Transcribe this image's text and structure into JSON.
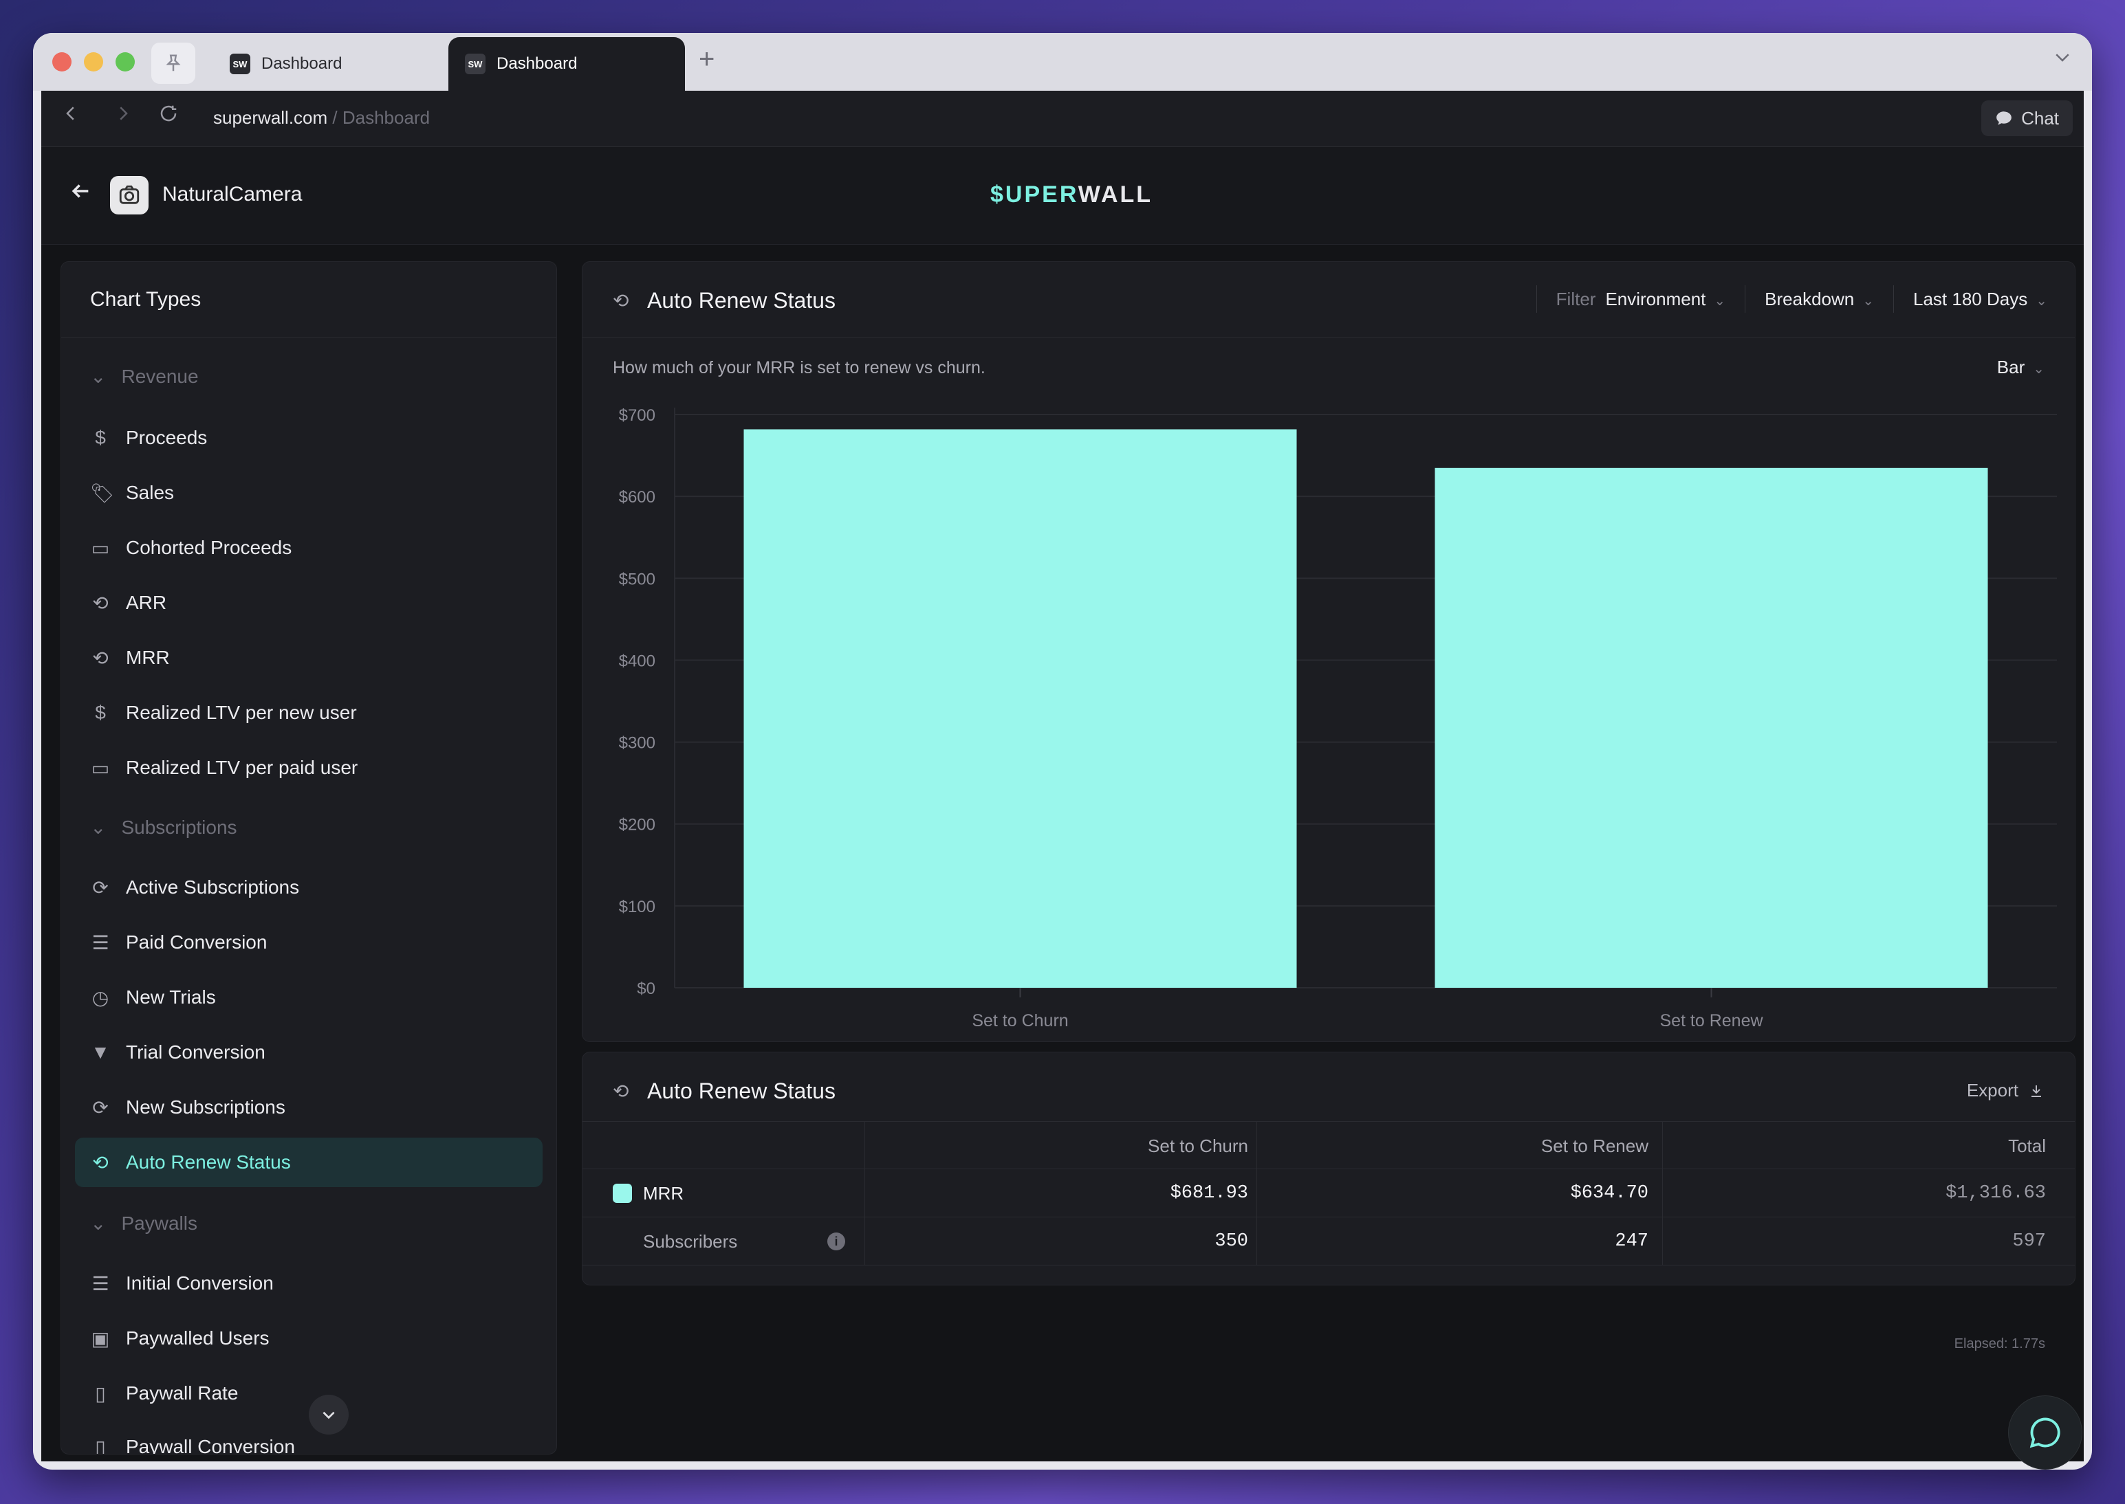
{
  "browser": {
    "tabs": [
      {
        "favicon": "SW",
        "label": "Dashboard"
      },
      {
        "favicon": "SW",
        "label": "Dashboard"
      }
    ],
    "new_tab": "+",
    "url_domain": "superwall.com",
    "url_path": " / Dashboard",
    "chat_label": "Chat"
  },
  "app": {
    "name": "NaturalCamera",
    "logo_accent": "$UPER",
    "logo_rest": "WALL"
  },
  "sidebar": {
    "title": "Chart Types",
    "sections": [
      {
        "label": "Revenue",
        "items": [
          {
            "label": "Proceeds",
            "icon": "dollar-icon"
          },
          {
            "label": "Sales",
            "icon": "tag-icon"
          },
          {
            "label": "Cohorted Proceeds",
            "icon": "calendar-icon"
          },
          {
            "label": "ARR",
            "icon": "recurring-dollar-icon"
          },
          {
            "label": "MRR",
            "icon": "recurring-dollar-icon"
          },
          {
            "label": "Realized LTV per new user",
            "icon": "dollar-icon"
          },
          {
            "label": "Realized LTV per paid user",
            "icon": "calendar-icon"
          }
        ]
      },
      {
        "label": "Subscriptions",
        "items": [
          {
            "label": "Active Subscriptions",
            "icon": "repeat-icon"
          },
          {
            "label": "Paid Conversion",
            "icon": "filter-lines-icon"
          },
          {
            "label": "New Trials",
            "icon": "timer-icon"
          },
          {
            "label": "Trial Conversion",
            "icon": "funnel-icon"
          },
          {
            "label": "New Subscriptions",
            "icon": "refresh-icon"
          },
          {
            "label": "Auto Renew Status",
            "icon": "auto-renew-icon",
            "active": true
          }
        ]
      },
      {
        "label": "Paywalls",
        "items": [
          {
            "label": "Initial Conversion",
            "icon": "filter-lines-icon"
          },
          {
            "label": "Paywalled Users",
            "icon": "badge-icon"
          },
          {
            "label": "Paywall Rate",
            "icon": "phone-icon"
          },
          {
            "label": "Paywall Conversion",
            "icon": "phone-icon"
          }
        ]
      }
    ]
  },
  "chart_card": {
    "title": "Auto Renew Status",
    "filter_label": "Filter",
    "filter_value": "Environment",
    "breakdown_label": "Breakdown",
    "range_label": "Last 180 Days",
    "subtitle": "How much of your MRR is set to renew vs churn.",
    "chart_type_label": "Bar"
  },
  "chart_data": {
    "type": "bar",
    "categories": [
      "Set to Churn",
      "Set to Renew"
    ],
    "values": [
      681.93,
      634.7
    ],
    "title": "Auto Renew Status",
    "xlabel": "",
    "ylabel": "",
    "ylim": [
      0,
      700
    ],
    "y_ticks": [
      "$0",
      "$100",
      "$200",
      "$300",
      "$400",
      "$500",
      "$600",
      "$700"
    ],
    "grid": true,
    "bar_color": "#9af7ec"
  },
  "table_card": {
    "title": "Auto Renew Status",
    "export_label": "Export",
    "columns": [
      "",
      "Set to Churn",
      "Set to Renew",
      "Total"
    ],
    "rows": [
      {
        "name": "MRR",
        "churn": "$681.93",
        "renew": "$634.70",
        "total": "$1,316.63"
      },
      {
        "name": "Subscribers",
        "churn": "350",
        "renew": "247",
        "total": "597"
      }
    ]
  },
  "footer": {
    "elapsed": "Elapsed: 1.77s"
  },
  "colors": {
    "accent": "#7df0e1",
    "bar": "#9af7ec",
    "background": "#131417",
    "card": "#1c1d22"
  }
}
